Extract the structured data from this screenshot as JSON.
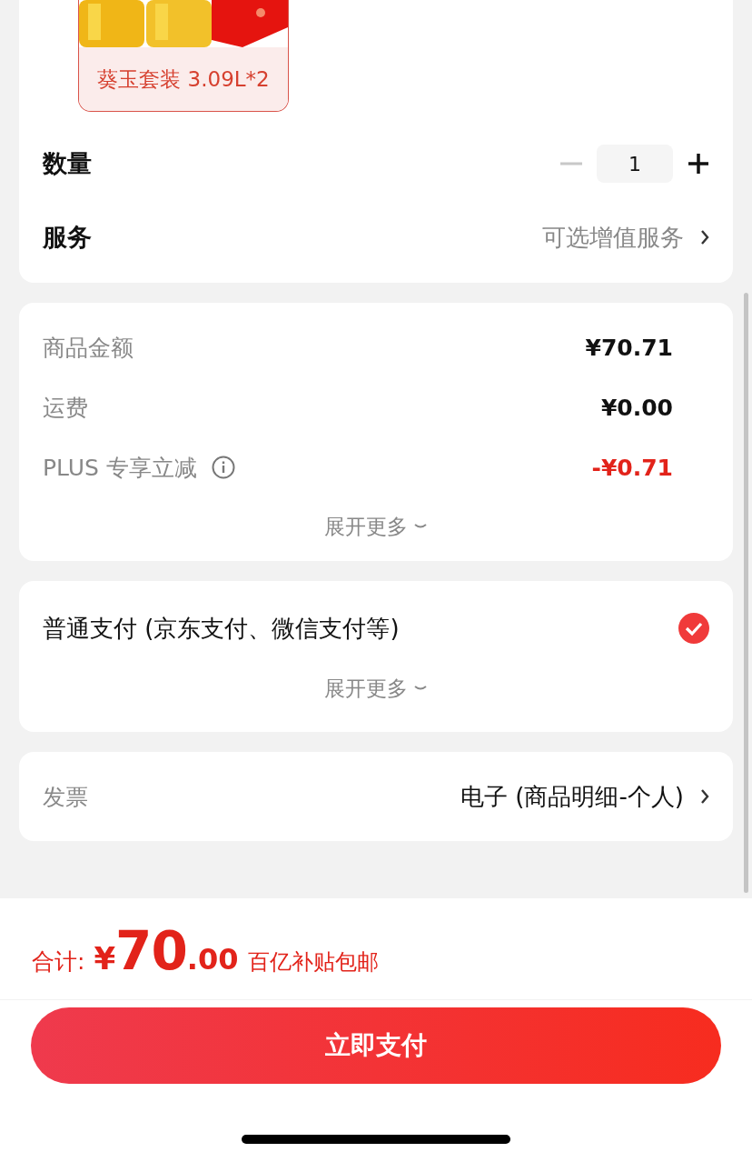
{
  "product": {
    "label": "葵玉套装 3.09L*2",
    "selected": true
  },
  "quantity": {
    "label": "数量",
    "value": "1",
    "minus_disabled": true
  },
  "service": {
    "label": "服务",
    "value": "可选增值服务"
  },
  "price_rows": [
    {
      "label": "商品金额",
      "value": "¥70.71",
      "kind": "normal"
    },
    {
      "label": "运费",
      "value": "¥0.00",
      "kind": "normal"
    },
    {
      "label": "PLUS 专享立减",
      "value": "-¥0.71",
      "kind": "discount",
      "info": true
    }
  ],
  "price_expand": "展开更多",
  "payment": {
    "label": "普通支付 (京东支付、微信支付等)",
    "selected": true,
    "expand": "展开更多"
  },
  "invoice": {
    "label": "发票",
    "value": "电子 (商品明细-个人)"
  },
  "total": {
    "label": "合计:",
    "currency": "¥",
    "integer": "70",
    "decimals": ".00",
    "note": "百亿补贴包邮"
  },
  "pay_button": "立即支付"
}
